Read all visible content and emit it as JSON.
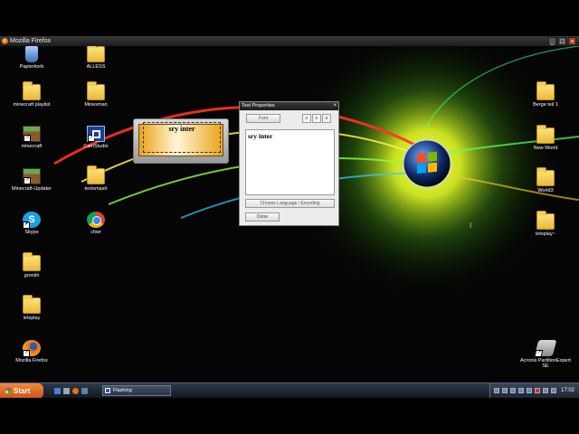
{
  "window": {
    "title": "Mozilla Firefox"
  },
  "desktop_icons": [
    {
      "label": "Papierkorb",
      "icon": "recycle-bin-icon"
    },
    {
      "label": "ALLESS",
      "icon": "folder-icon"
    },
    {
      "label": "minecraft playlist",
      "icon": "folder-icon"
    },
    {
      "label": "Minesman",
      "icon": "folder-icon"
    },
    {
      "label": "minecraft",
      "icon": "minecraft-icon"
    },
    {
      "label": "CamStudio",
      "icon": "camstudio-icon"
    },
    {
      "label": "Minecraft-Updater",
      "icon": "minecraft-icon"
    },
    {
      "label": "textsmash",
      "icon": "folder-icon"
    },
    {
      "label": "Skype",
      "icon": "skype-icon"
    },
    {
      "label": "chwr",
      "icon": "chrome-icon"
    },
    {
      "label": "gronkh",
      "icon": "folder-icon"
    },
    {
      "label": "letsplay",
      "icon": "folder-icon"
    },
    {
      "label": "Mozilla Firefox",
      "icon": "firefox-icon"
    },
    {
      "label": "Berge teil 1",
      "icon": "folder-icon"
    },
    {
      "label": "New World",
      "icon": "folder-icon"
    },
    {
      "label": "World3",
      "icon": "folder-icon"
    },
    {
      "label": "letsplay~",
      "icon": "folder-icon"
    },
    {
      "label": "Acronis PartitionExpert SE",
      "icon": "hard-drive-icon"
    }
  ],
  "edit_box": {
    "text": "sry inter"
  },
  "dialog": {
    "title": "Text Properties",
    "close": "×",
    "font_button": "Font",
    "align_buttons": [
      "≡",
      "≡",
      "≡"
    ],
    "text_value": "sry inter",
    "language_button": "Choose Language / Encoding",
    "done_button": "Done"
  },
  "cursor": "I",
  "taskbar": {
    "start_label": "Start",
    "task_label": "Flashing",
    "clock": "17:02"
  }
}
